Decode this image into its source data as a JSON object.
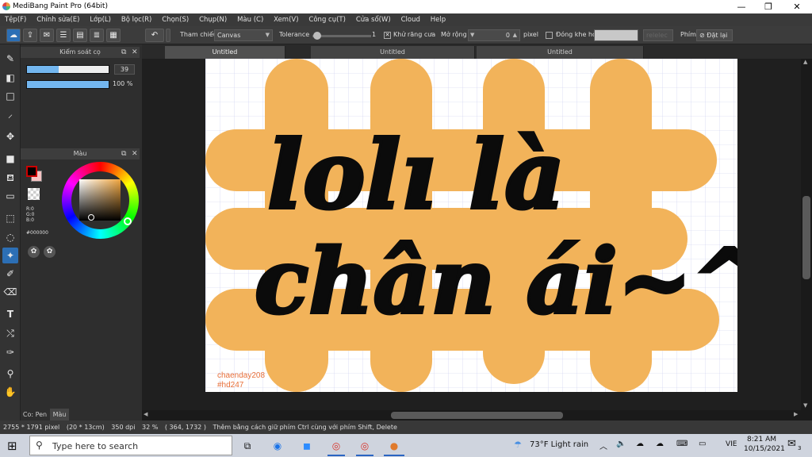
{
  "window": {
    "title": "MediBang Paint Pro (64bit)",
    "minimize": "—",
    "maximize": "❐",
    "close": "✕"
  },
  "menu": [
    "Tệp(F)",
    "Chỉnh sửa(E)",
    "Lớp(L)",
    "Bộ lọc(R)",
    "Chọn(S)",
    "Chụp(N)",
    "Màu (C)",
    "Xem(V)",
    "Công cụ(T)",
    "Cửa sổ(W)",
    "Cloud",
    "Help"
  ],
  "toolbar": {
    "reference_label": "Tham chiếu",
    "reference_value": "Canvas",
    "tolerance_label": "Tolerance",
    "tolerance_value": "1",
    "tolerance_fraction": 0.02,
    "antialias_label": "Khử răng cưa",
    "antialias_checked": "✕",
    "expand_label": "Mở rộng",
    "expand_value": "0",
    "expand_unit": "pixel",
    "close_gap_label": "Đóng khe hở",
    "close_gap_value": "",
    "select_label": "relelec",
    "key_label": "Phím",
    "reset_label": "Đặt lại"
  },
  "brush_panel": {
    "title": "Kiểm soát cọ",
    "size_value": "39",
    "size_fraction": 0.39,
    "opacity_value": "100 %",
    "opacity_fraction": 1.0
  },
  "color_panel": {
    "title": "Màu",
    "r": "R:0",
    "g": "G:0",
    "b": "B:0",
    "hex": "#000000",
    "fg_color": "#000000",
    "bg_color": "#f6c3c3"
  },
  "panel_tabs": {
    "brush_tab": "Co: Pen",
    "color_tab": "Màu"
  },
  "tabs": [
    "Untitled",
    "Untitled",
    "Untitled"
  ],
  "canvas": {
    "bg_color": "#f2b35a",
    "line1": "lolı là",
    "line2": "chân ái~^",
    "watermark1": "chaenday208",
    "watermark2": "#hd247",
    "watermark_color": "#e8703a"
  },
  "status": {
    "size": "2755 * 1791 pixel",
    "physical": "(20 * 13cm)",
    "dpi": "350 dpi",
    "zoom": "32 %",
    "coords": "( 364, 1732 )",
    "hint": "Thêm bằng cách giữ phím Ctrl cùng với phím Shift, Delete"
  },
  "taskbar": {
    "search_placeholder": "Type here to search",
    "weather": "73°F  Light rain",
    "lang": "VIE",
    "time": "8:21 AM",
    "date": "10/15/2021",
    "notif": "3"
  }
}
